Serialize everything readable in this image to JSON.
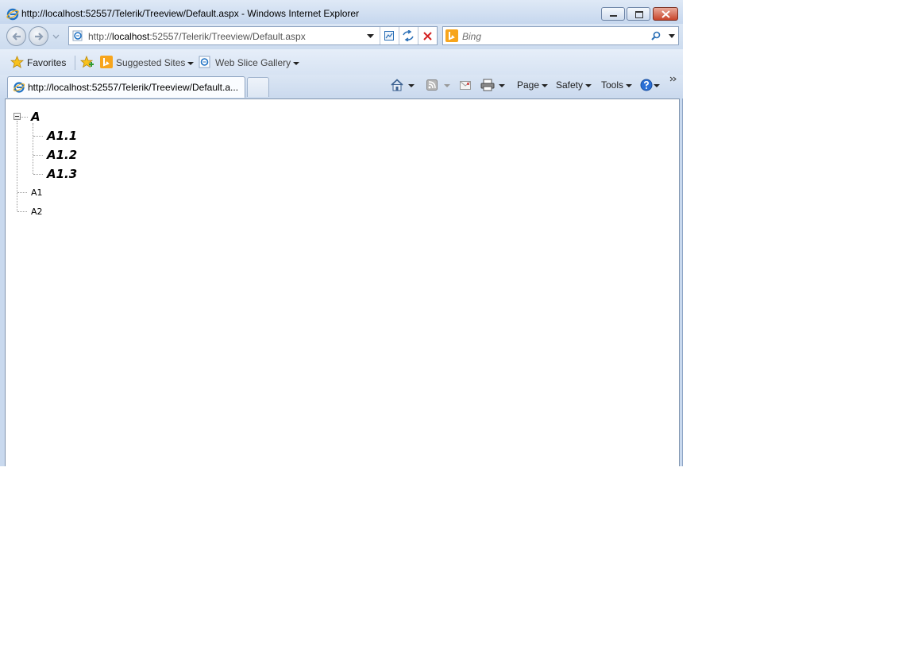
{
  "window": {
    "title": "http://localhost:52557/Telerik/Treeview/Default.aspx - Windows Internet Explorer"
  },
  "address_bar": {
    "url_prefix": "http://",
    "url_host": "localhost",
    "url_rest": ":52557/Telerik/Treeview/Default.aspx"
  },
  "search": {
    "placeholder": "Bing"
  },
  "favorites_bar": {
    "favorites": "Favorites",
    "suggested_sites": "Suggested Sites",
    "web_slice_gallery": "Web Slice Gallery"
  },
  "tab": {
    "title": "http://localhost:52557/Telerik/Treeview/Default.a..."
  },
  "command_bar": {
    "page": "Page",
    "safety": "Safety",
    "tools": "Tools"
  },
  "tree": {
    "root": "A",
    "children": [
      "A1.1",
      "A1.2",
      "A1.3"
    ],
    "siblings": [
      "A1",
      "A2"
    ]
  },
  "colors": {
    "chrome": "#c9d9ee",
    "close_button": "#c9452b",
    "bing": "#f7a51c",
    "ie_blue": "#1f72c4"
  }
}
